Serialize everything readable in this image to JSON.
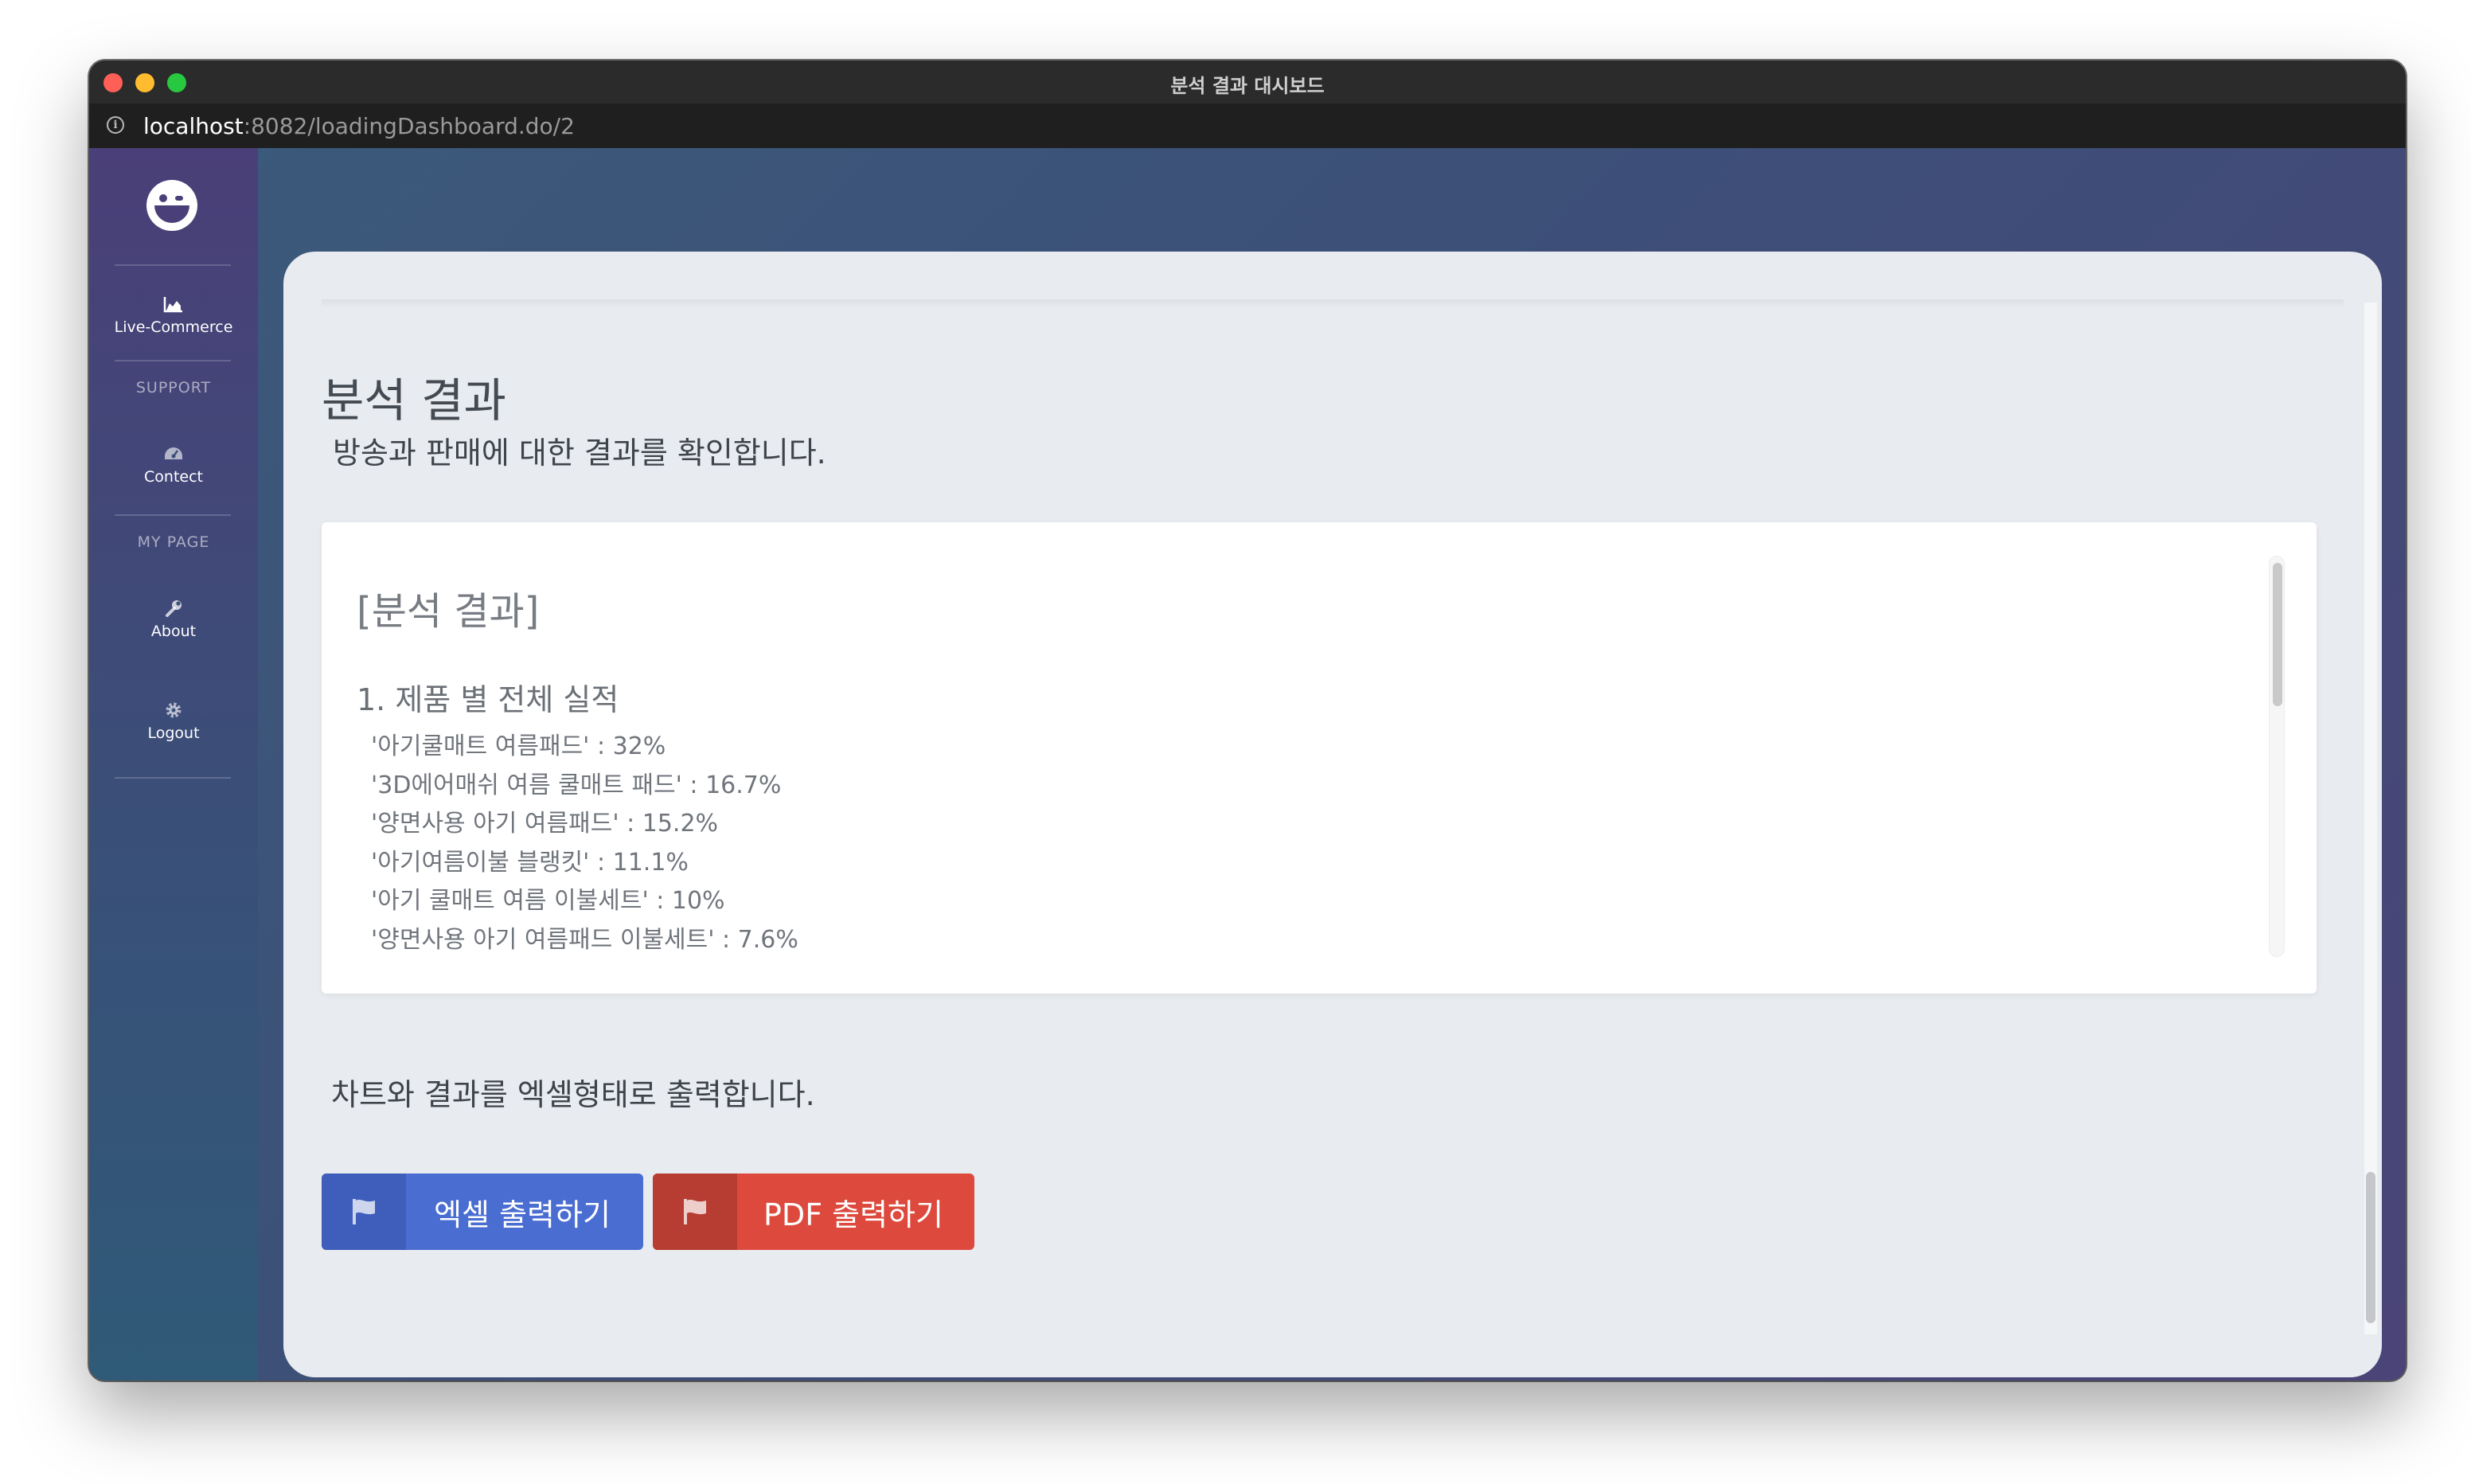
{
  "window": {
    "title": "분석 결과 대시보드"
  },
  "browser": {
    "url_host": "localhost",
    "url_rest": ":8082/loadingDashboard.do/2"
  },
  "sidebar": {
    "items": [
      {
        "label": "Live-Commerce",
        "icon": "area-chart-icon"
      },
      {
        "label": "Contect",
        "icon": "dashboard-gauge-icon"
      },
      {
        "label": "About",
        "icon": "wrench-icon"
      },
      {
        "label": "Logout",
        "icon": "gear-icon"
      }
    ],
    "sections": {
      "support": "SUPPORT",
      "mypage": "MY PAGE"
    }
  },
  "main": {
    "title": "분석 결과",
    "subtitle": "방송과 판매에 대한 결과를 확인합니다.",
    "result": {
      "title": "[분석 결과]",
      "section1": "1. 제품 별 전체 실적",
      "lines": [
        "'아기쿨매트 여름패드' : 32%",
        "'3D에어매쉬 여름 쿨매트 패드' : 16.7%",
        "'양면사용 아기 여름패드' : 15.2%",
        "'아기여름이불 블랭킷' : 11.1%",
        "'아기 쿨매트 여름 이불세트' : 10%",
        "'양면사용 아기 여름패드 이불세트' : 7.6%"
      ]
    },
    "export_text": "차트와 결과를 엑셀형태로 출력합니다.",
    "buttons": {
      "excel": "엑셀 출력하기",
      "pdf": "PDF 출력하기"
    }
  },
  "colors": {
    "excel_button": "#4a6dd2",
    "pdf_button": "#dd4a3d"
  }
}
